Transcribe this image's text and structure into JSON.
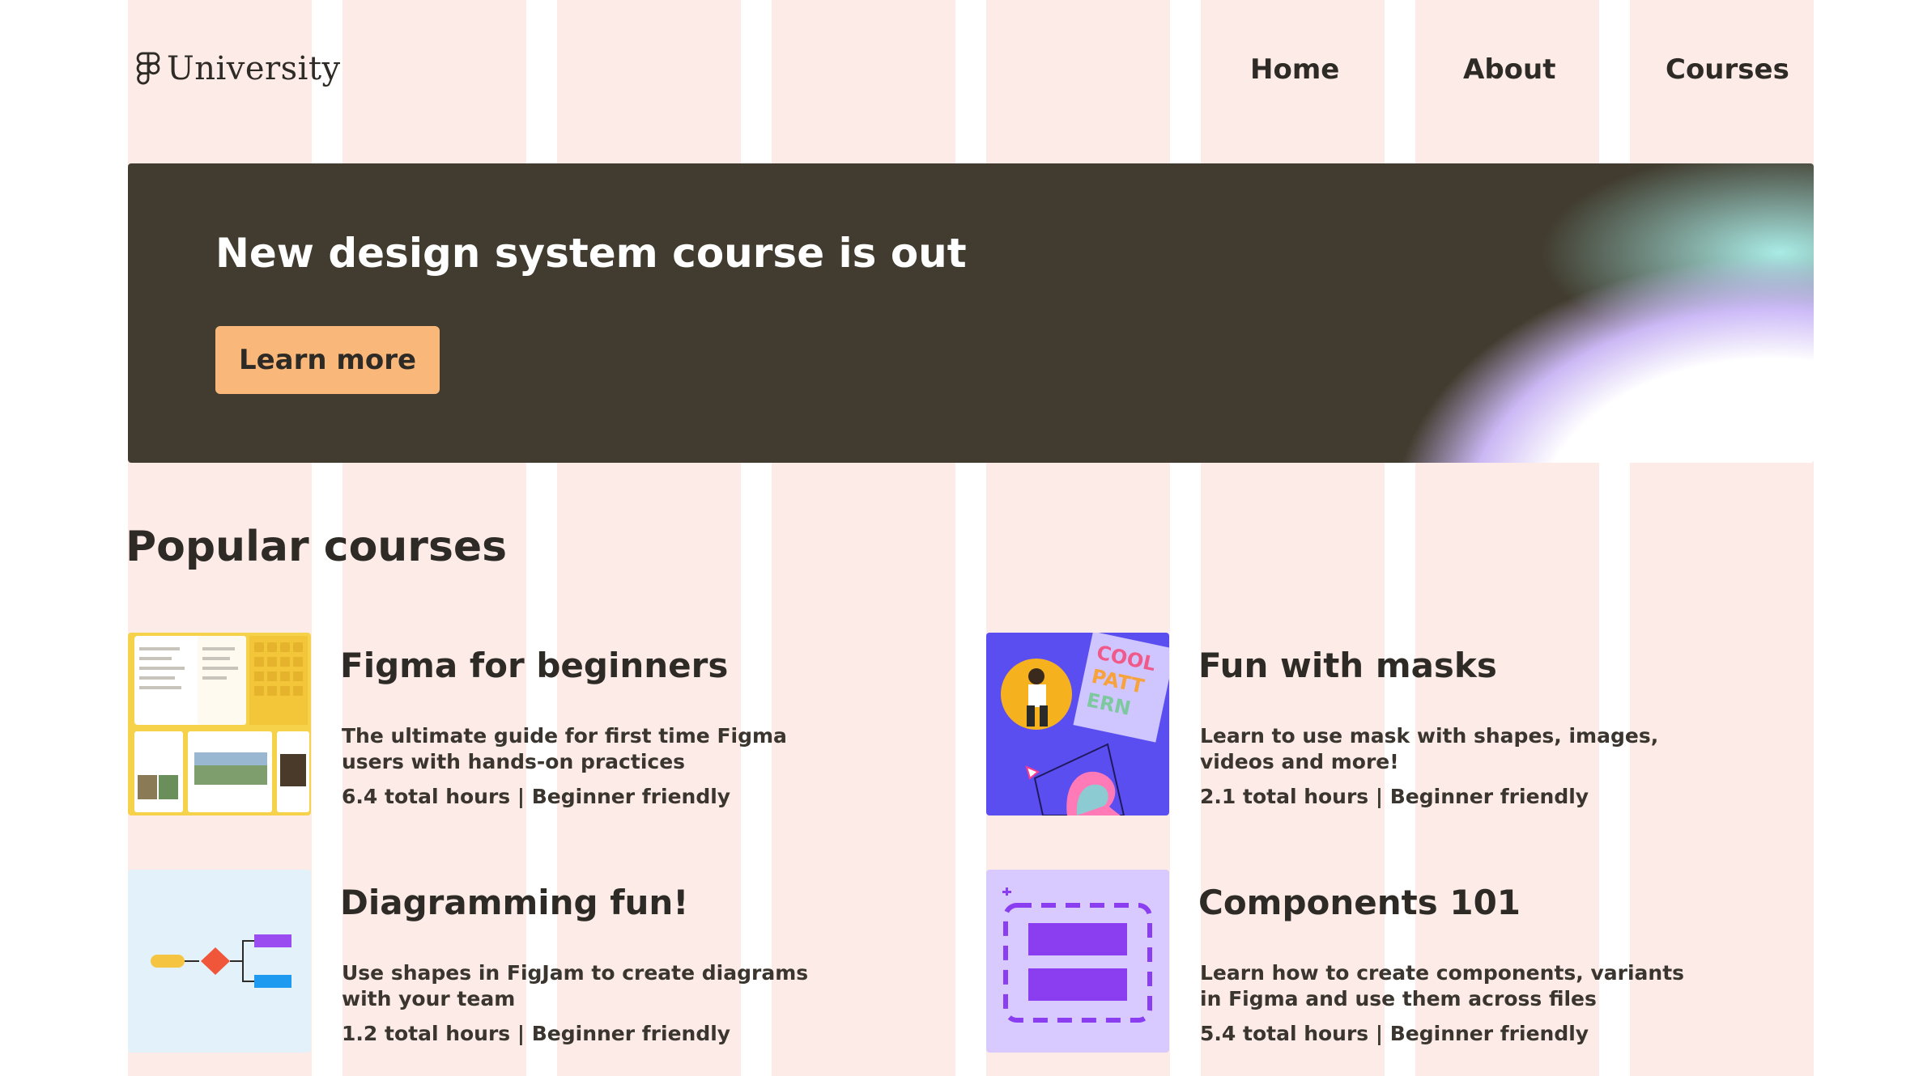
{
  "header": {
    "logo_text": "University",
    "nav": [
      {
        "label": "Home"
      },
      {
        "label": "About"
      },
      {
        "label": "Courses"
      }
    ]
  },
  "banner": {
    "title": "New design system course is out",
    "button_label": "Learn more"
  },
  "popular": {
    "heading": "Popular courses",
    "courses": [
      {
        "title": "Figma for beginners",
        "description": "The ultimate guide for first time Figma users with hands-on practices",
        "meta": "6.4 total hours | Beginner friendly",
        "thumbnail_icon": "figma-beginners-thumbnail"
      },
      {
        "title": "Fun with masks",
        "description": "Learn to use mask with shapes, images, videos and more!",
        "meta": "2.1 total hours | Beginner friendly",
        "thumbnail_icon": "masks-thumbnail",
        "thumbnail_text": "COOL PATT ERN"
      },
      {
        "title": "Diagramming fun!",
        "description": "Use shapes in FigJam to create diagrams with your team",
        "meta": "1.2 total hours | Beginner friendly",
        "thumbnail_icon": "flowchart-thumbnail"
      },
      {
        "title": "Components 101",
        "description": "Learn how to create components, variants in Figma and use them across files",
        "meta": "5.4 total hours | Beginner friendly",
        "thumbnail_icon": "component-thumbnail"
      }
    ]
  },
  "colors": {
    "grid_column": "#fdebe7",
    "banner_bg": "#413c2f",
    "button_bg": "#f9b87a",
    "text": "#2e2b26"
  }
}
